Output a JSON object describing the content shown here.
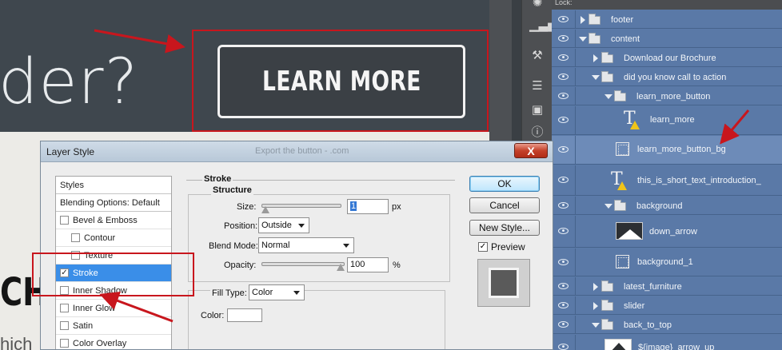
{
  "canvas": {
    "headline": "der?",
    "cta_label": "LEARN MORE",
    "big_text": "CHU",
    "small_text": "hich"
  },
  "dialog": {
    "title": "Layer Style",
    "ghost_title": "Export the button - .com",
    "close_label": "X",
    "styles_header": "Styles",
    "blending_options": "Blending Options: Default",
    "styles": [
      {
        "label": "Bevel & Emboss",
        "checked": false,
        "indent": false
      },
      {
        "label": "Contour",
        "checked": false,
        "indent": true
      },
      {
        "label": "Texture",
        "checked": false,
        "indent": true
      },
      {
        "label": "Stroke",
        "checked": true,
        "indent": false,
        "selected": true
      },
      {
        "label": "Inner Shadow",
        "checked": false,
        "indent": false
      },
      {
        "label": "Inner Glow",
        "checked": false,
        "indent": false
      },
      {
        "label": "Satin",
        "checked": false,
        "indent": false
      },
      {
        "label": "Color Overlay",
        "checked": false,
        "indent": false
      }
    ],
    "stroke": {
      "section_title": "Stroke",
      "structure_title": "Structure",
      "size_label": "Size:",
      "size_value": "1",
      "size_unit": "px",
      "position_label": "Position:",
      "position_value": "Outside",
      "blend_label": "Blend Mode:",
      "blend_value": "Normal",
      "opacity_label": "Opacity:",
      "opacity_value": "100",
      "opacity_unit": "%",
      "opacity_level": 1.0,
      "size_level": 0.0,
      "fill_type_label": "Fill Type:",
      "fill_type_value": "Color",
      "color_label": "Color:",
      "color_value": "#ffffff"
    },
    "buttons": {
      "ok": "OK",
      "cancel": "Cancel",
      "new_style": "New Style...",
      "preview": "Preview"
    },
    "preview_checked": true
  },
  "layers_panel": {
    "top_label": "Lock:",
    "rows": [
      {
        "name": "footer",
        "type": "folder",
        "expanded": false,
        "depth": 0
      },
      {
        "name": "content",
        "type": "folder",
        "expanded": true,
        "depth": 0
      },
      {
        "name": "Download our Brochure",
        "type": "folder",
        "expanded": false,
        "depth": 1
      },
      {
        "name": "did you know call to action",
        "type": "folder",
        "expanded": true,
        "depth": 1
      },
      {
        "name": "learn_more_button",
        "type": "folder",
        "expanded": true,
        "depth": 2
      },
      {
        "name": "learn_more",
        "type": "text",
        "depth": 3
      },
      {
        "name": "learn_more_button_bg",
        "type": "shape",
        "depth": 3,
        "selected": true
      },
      {
        "name": "this_is_short_text_introduction_",
        "type": "text",
        "depth": 2
      },
      {
        "name": "background",
        "type": "folder",
        "expanded": true,
        "depth": 2
      },
      {
        "name": "down_arrow",
        "type": "thumbnail",
        "depth": 3
      },
      {
        "name": "background_1",
        "type": "shape",
        "depth": 3
      },
      {
        "name": "latest_furniture",
        "type": "folder",
        "expanded": false,
        "depth": 1
      },
      {
        "name": "slider",
        "type": "folder",
        "expanded": false,
        "depth": 1
      },
      {
        "name": "back_to_top",
        "type": "folder",
        "expanded": true,
        "depth": 1
      },
      {
        "name": "${image}_arrow_up",
        "type": "thumbnail",
        "depth": 2
      }
    ]
  },
  "colors": {
    "annotation_red": "#c8161d",
    "selection_blue": "#3a8ee8",
    "panel_blue": "#5a79a7"
  }
}
